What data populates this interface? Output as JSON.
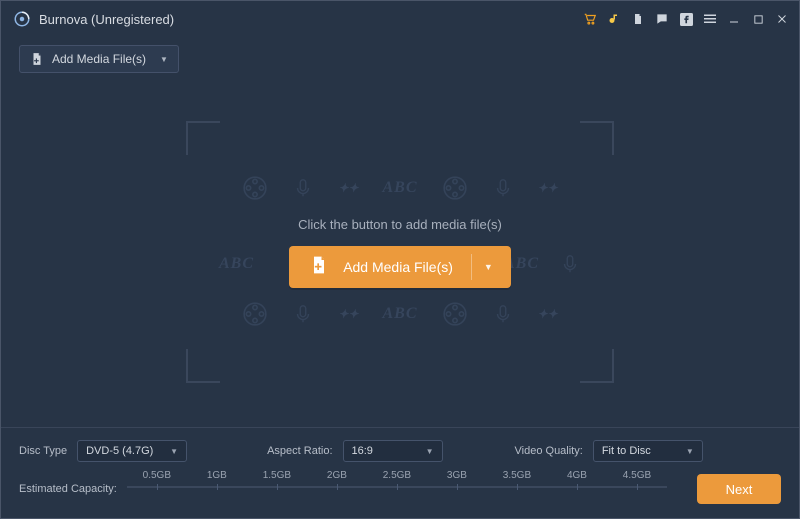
{
  "title": "Burnova (Unregistered)",
  "toolbar": {
    "add_small_label": "Add Media File(s)"
  },
  "main": {
    "hint": "Click the button to add media file(s)",
    "add_big_label": "Add Media File(s)",
    "bg_abc": "ABC"
  },
  "controls": {
    "disc_type_label": "Disc Type",
    "disc_type_value": "DVD-5 (4.7G)",
    "aspect_ratio_label": "Aspect Ratio:",
    "aspect_ratio_value": "16:9",
    "video_quality_label": "Video Quality:",
    "video_quality_value": "Fit to Disc",
    "capacity_label": "Estimated Capacity:",
    "ticks": [
      "0.5GB",
      "1GB",
      "1.5GB",
      "2GB",
      "2.5GB",
      "3GB",
      "3.5GB",
      "4GB",
      "4.5GB"
    ],
    "next_label": "Next"
  }
}
